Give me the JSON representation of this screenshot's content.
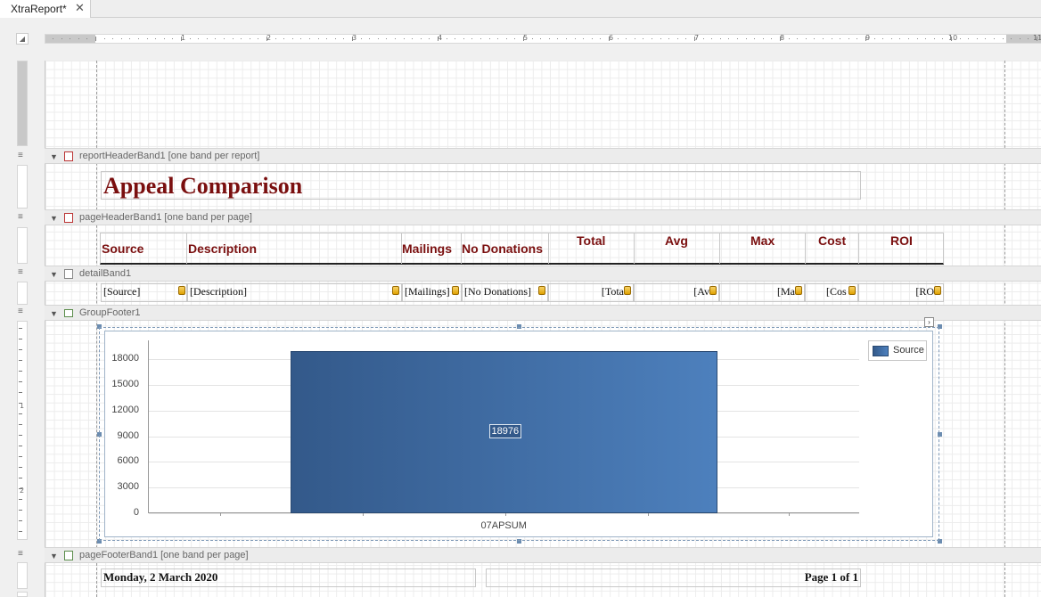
{
  "tab": {
    "title": "XtraReport*",
    "close_glyph": "✕"
  },
  "ruler": {
    "corner_glyph": "◢",
    "numbers": [
      "1",
      "2",
      "3",
      "4",
      "5",
      "6",
      "7",
      "8",
      "9",
      "10",
      "11"
    ]
  },
  "vruler_numbers": [
    "1",
    "2"
  ],
  "bands": {
    "report_header": "reportHeaderBand1 [one band per report]",
    "page_header": "pageHeaderBand1 [one band per page]",
    "detail": "detailBand1",
    "group_footer": "GroupFooter1",
    "page_footer": "pageFooterBand1 [one band per page]"
  },
  "report_title": "Appeal Comparison",
  "headers": [
    "Source",
    "Description",
    "Mailings",
    "No Donations",
    "Total",
    "Avg",
    "Max",
    "Cost",
    "ROI"
  ],
  "detail_fields": [
    "[Source]",
    "[Description]",
    "[Mailings]",
    "[No Donations]",
    "[Tota",
    "[Av",
    "[Ma",
    "[Cos",
    "[RO"
  ],
  "footer": {
    "date": "Monday, 2 March 2020",
    "page": "Page 1 of 1"
  },
  "chart_data": {
    "type": "bar",
    "categories": [
      "07APSUM"
    ],
    "series": [
      {
        "name": "Source",
        "values": [
          18976
        ]
      }
    ],
    "data_labels": [
      "18976"
    ],
    "yticks": [
      "0",
      "3000",
      "6000",
      "9000",
      "12000",
      "15000",
      "18000"
    ],
    "ylim": [
      0,
      20200
    ],
    "legend": "top-right",
    "colors": {
      "bar_start": "#33598a",
      "bar_end": "#4d80bd"
    }
  }
}
